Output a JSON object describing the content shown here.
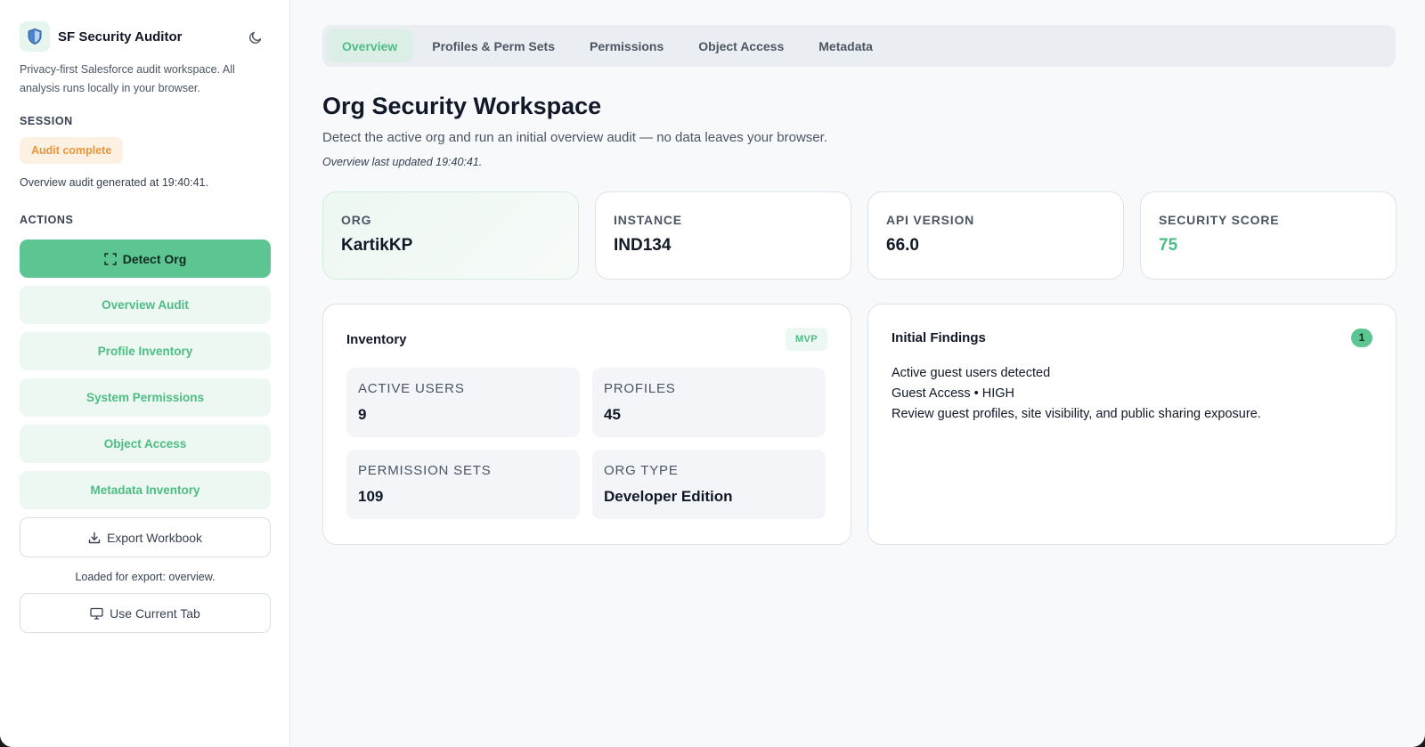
{
  "app": {
    "title": "SF Security Auditor",
    "description": "Privacy-first Salesforce audit workspace. All analysis runs locally in your browser."
  },
  "session": {
    "label": "SESSION",
    "status": "Audit complete",
    "note": "Overview audit generated at 19:40:41."
  },
  "actions": {
    "label": "ACTIONS",
    "detect_org": "Detect Org",
    "overview_audit": "Overview Audit",
    "profile_inventory": "Profile Inventory",
    "system_permissions": "System Permissions",
    "object_access": "Object Access",
    "metadata_inventory": "Metadata Inventory",
    "export_workbook": "Export Workbook",
    "export_note": "Loaded for export: overview.",
    "use_current_tab": "Use Current Tab"
  },
  "tabs": [
    {
      "label": "Overview"
    },
    {
      "label": "Profiles & Perm Sets"
    },
    {
      "label": "Permissions"
    },
    {
      "label": "Object Access"
    },
    {
      "label": "Metadata"
    }
  ],
  "page": {
    "title": "Org Security Workspace",
    "subtitle": "Detect the active org and run an initial overview audit — no data leaves your browser.",
    "updated": "Overview last updated 19:40:41."
  },
  "stats": [
    {
      "label": "ORG",
      "value": "KartikKP"
    },
    {
      "label": "INSTANCE",
      "value": "IND134"
    },
    {
      "label": "API VERSION",
      "value": "66.0"
    },
    {
      "label": "SECURITY SCORE",
      "value": "75"
    }
  ],
  "inventory": {
    "title": "Inventory",
    "badge": "MVP",
    "items": [
      {
        "label": "ACTIVE USERS",
        "value": "9"
      },
      {
        "label": "PROFILES",
        "value": "45"
      },
      {
        "label": "PERMISSION SETS",
        "value": "109"
      },
      {
        "label": "ORG TYPE",
        "value": "Developer Edition"
      }
    ]
  },
  "findings": {
    "title": "Initial Findings",
    "count": "1",
    "items": [
      {
        "title": "Active guest users detected",
        "meta": "Guest Access • HIGH",
        "detail": "Review guest profiles, site visibility, and public sharing exposure."
      }
    ]
  },
  "colors": {
    "accent": "#5cc592",
    "accent_text": "#4dbd84",
    "status_warning_bg": "#fdf1e3",
    "status_warning_text": "#e8963a"
  },
  "icons": {
    "brand": "shield-icon",
    "theme": "moon-icon",
    "detect": "scan-frame-icon",
    "export": "download-icon",
    "tab": "monitor-icon"
  }
}
